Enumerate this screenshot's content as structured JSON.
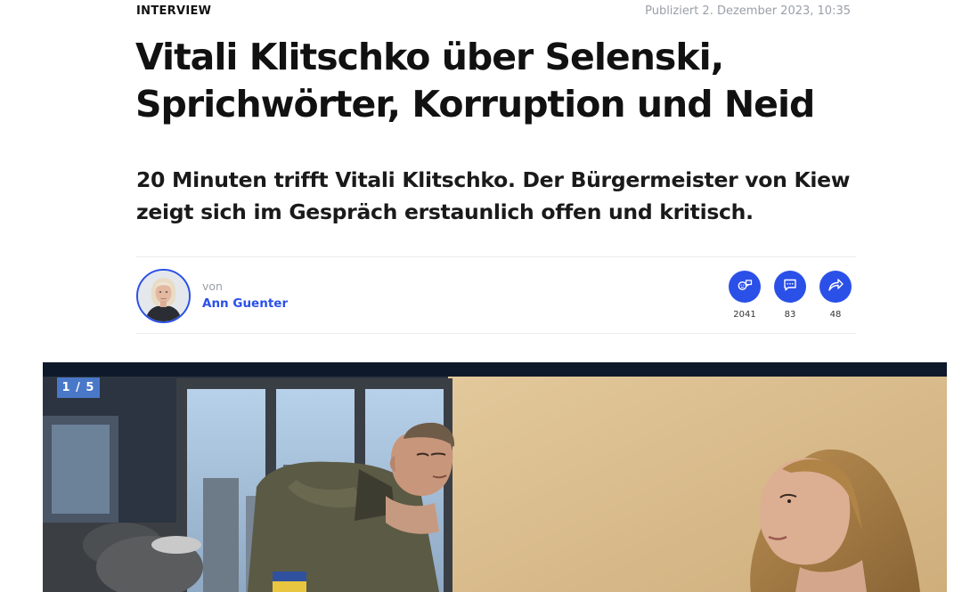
{
  "article": {
    "kicker": "INTERVIEW",
    "published": "Publiziert 2. Dezember 2023, 10:35",
    "headline": "Vitali Klitschko über Selenski, Sprichwörter, Korruption und Neid",
    "lead": "20 Minuten trifft Vitali Klitschko. Der Bürgermeister von Kiew zeigt sich im Gespräch erstaunlich offen und kritisch."
  },
  "author": {
    "by_label": "von",
    "name": "Ann Guenter"
  },
  "actions": [
    {
      "icon": "reactions-icon",
      "count": "2041"
    },
    {
      "icon": "comment-icon",
      "count": "83"
    },
    {
      "icon": "share-icon",
      "count": "48"
    }
  ],
  "gallery": {
    "counter": "1 / 5"
  },
  "colors": {
    "accent": "#2b50e8",
    "counter_bg": "#4a78c8",
    "muted_text": "#9aa0a8"
  }
}
